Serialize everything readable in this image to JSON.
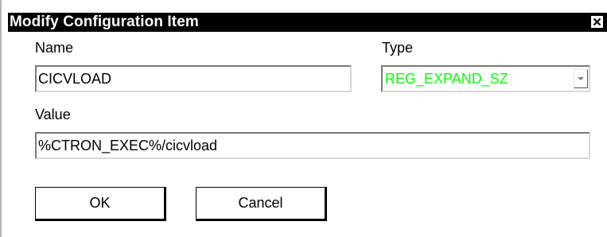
{
  "dialog": {
    "title": "Modify Configuration Item",
    "close_icon": "close-icon"
  },
  "form": {
    "name_label": "Name",
    "name_value": "CICVLOAD",
    "type_label": "Type",
    "type_value": "REG_EXPAND_SZ",
    "type_value_color": "#00ff00",
    "type_dropdown_icon": "chevron-down-icon",
    "value_label": "Value",
    "value_value": "%CTRON_EXEC%/cicvload"
  },
  "buttons": {
    "ok_label": "OK",
    "cancel_label": "Cancel"
  }
}
